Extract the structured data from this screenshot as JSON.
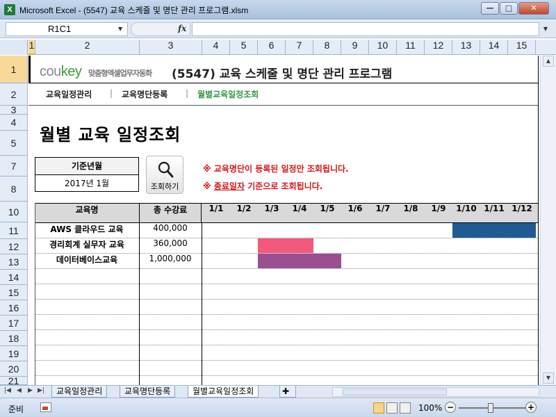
{
  "window": {
    "title": "Microsoft Excel - (5547) 교육 스케줄 및 명단 관리 프로그램.xlsm",
    "app_icon_letter": "X",
    "btn_min": "—",
    "btn_max": "□",
    "btn_close": "✕"
  },
  "formula_bar": {
    "name_box": "R1C1",
    "fx_label": "fx",
    "formula": ""
  },
  "columns": [
    "1",
    "2",
    "3",
    "4",
    "5",
    "6",
    "7",
    "8",
    "9",
    "10",
    "11",
    "12",
    "13",
    "14",
    "15"
  ],
  "rows": [
    "1",
    "2",
    "3",
    "4",
    "5",
    "7",
    "8",
    "10",
    "11",
    "12",
    "13",
    "14",
    "15",
    "16",
    "17",
    "18",
    "19",
    "20",
    "21"
  ],
  "header": {
    "logo_main": "cou",
    "logo_accent": "key",
    "logo_sub": "맞춤형엑셀업무자동화",
    "title": "(5547) 교육 스케줄 및 명단 관리 프로그램"
  },
  "nav": {
    "items": [
      "교육일정관리",
      "교육명단등록",
      "월별교육일정조회"
    ],
    "separator": "|",
    "active_index": 2
  },
  "page": {
    "heading": "월별 교육 일정조회"
  },
  "filter": {
    "base_label": "기준년월",
    "base_value": "2017년 1월",
    "search_button": "조회하기",
    "notice1": "※ 교육명단이 등록된 일정만 조회됩니다.",
    "notice2_prefix": "※ ",
    "notice2_underlined": "종료일자",
    "notice2_suffix": " 기준으로 조회됩니다."
  },
  "table": {
    "col_name": "교육명",
    "col_fee": "총 수강료",
    "months": [
      "1/1",
      "1/2",
      "1/3",
      "1/4",
      "1/5",
      "1/6",
      "1/7",
      "1/8",
      "1/9",
      "1/10",
      "1/11",
      "1/12"
    ],
    "rows": [
      {
        "name": "AWS 클라우드 교육",
        "fee": "400,000",
        "bar_start": 9,
        "bar_end": 12,
        "color": "#1e5b93"
      },
      {
        "name": "경리회계 실무자 교육",
        "fee": "360,000",
        "bar_start": 2,
        "bar_end": 4,
        "color": "#f2597a"
      },
      {
        "name": "데이터베이스교육",
        "fee": "1,000,000",
        "bar_start": 2,
        "bar_end": 5,
        "color": "#9b4f90"
      }
    ]
  },
  "sheet_tabs": {
    "tabs": [
      "교육일정관리",
      "교육명단등록",
      "월별교육일정조회"
    ],
    "active_index": 2
  },
  "status": {
    "ready": "준비",
    "zoom": "100%"
  }
}
